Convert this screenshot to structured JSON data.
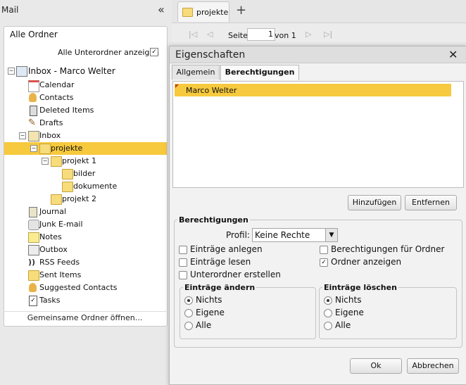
{
  "left": {
    "title": "Mail",
    "collapse_icon": "«",
    "all_folders": "Alle Ordner",
    "show_subfolders": "Alle Unterordner anzeigen",
    "show_subfolders_checked": "✓",
    "tree": [
      {
        "label": "Inbox - Marco Welter",
        "icon": "mailbox-icon"
      },
      {
        "label": "Calendar",
        "icon": "calendar-icon"
      },
      {
        "label": "Contacts",
        "icon": "contacts-icon"
      },
      {
        "label": "Deleted Items",
        "icon": "trash-icon"
      },
      {
        "label": "Drafts",
        "icon": "drafts-icon"
      },
      {
        "label": "Inbox",
        "icon": "inbox-icon"
      },
      {
        "label": "projekte",
        "icon": "folder-icon"
      },
      {
        "label": "projekt 1",
        "icon": "folder-icon"
      },
      {
        "label": "bilder",
        "icon": "folder-icon"
      },
      {
        "label": "dokumente",
        "icon": "folder-icon"
      },
      {
        "label": "projekt 2",
        "icon": "folder-icon"
      },
      {
        "label": "Journal",
        "icon": "journal-icon"
      },
      {
        "label": "Junk E-mail",
        "icon": "junk-icon"
      },
      {
        "label": "Notes",
        "icon": "notes-icon"
      },
      {
        "label": "Outbox",
        "icon": "outbox-icon"
      },
      {
        "label": "RSS Feeds",
        "icon": "rss-icon"
      },
      {
        "label": "Sent Items",
        "icon": "sent-icon"
      },
      {
        "label": "Suggested Contacts",
        "icon": "contacts-icon"
      },
      {
        "label": "Tasks",
        "icon": "tasks-icon"
      }
    ],
    "shared_open": "Gemeinsame Ordner öffnen..."
  },
  "tabs": {
    "active": "projekte",
    "add": "+"
  },
  "pager": {
    "seite": "Seite",
    "page": "1",
    "von": "von 1"
  },
  "dialog": {
    "title": "Eigenschaften",
    "close": "✕",
    "tab_general": "Allgemein",
    "tab_permissions": "Berechtigungen",
    "users": [
      "Marco Welter"
    ],
    "add_button": "Hinzufügen",
    "remove_button": "Entfernen",
    "group_label": "Berechtigungen",
    "profile_label": "Profil:",
    "profile_value": "Keine Rechte",
    "checks": {
      "create_items": "Einträge anlegen",
      "read_items": "Einträge lesen",
      "create_subfolders": "Unterordner erstellen",
      "folder_permissions": "Berechtigungen für Ordner",
      "show_folder": "Ordner anzeigen"
    },
    "show_folder_checked": "✓",
    "edit_group": {
      "label": "Einträge ändern",
      "options": [
        "Nichts",
        "Eigene",
        "Alle"
      ],
      "selected": "Nichts"
    },
    "delete_group": {
      "label": "Einträge löschen",
      "options": [
        "Nichts",
        "Eigene",
        "Alle"
      ],
      "selected": "Nichts"
    },
    "ok": "Ok",
    "cancel": "Abbrechen"
  },
  "colors": {
    "selection": "#f6c93e",
    "folder": "#f7dc7b"
  }
}
